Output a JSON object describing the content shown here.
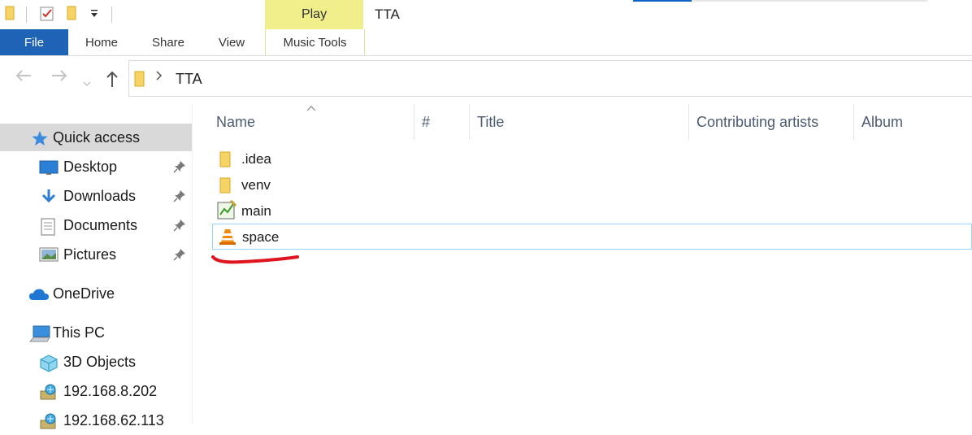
{
  "titlebar": {
    "window_title": "TTA",
    "contextual_group": "Play"
  },
  "ribbon": {
    "tabs": [
      {
        "label": "File"
      },
      {
        "label": "Home"
      },
      {
        "label": "Share"
      },
      {
        "label": "View"
      },
      {
        "label": "Music Tools"
      }
    ]
  },
  "address": {
    "path": "TTA"
  },
  "nav_pane": {
    "items": [
      {
        "label": "Quick access",
        "icon": "star-icon",
        "selected": true
      },
      {
        "label": "Desktop",
        "icon": "desktop-icon",
        "pinned": true
      },
      {
        "label": "Downloads",
        "icon": "download-arrow-icon",
        "pinned": true
      },
      {
        "label": "Documents",
        "icon": "document-icon",
        "pinned": true
      },
      {
        "label": "Pictures",
        "icon": "pictures-icon",
        "pinned": true
      },
      {
        "label": "OneDrive",
        "icon": "cloud-icon"
      },
      {
        "label": "This PC",
        "icon": "computer-icon"
      },
      {
        "label": "3D Objects",
        "icon": "cube-icon"
      },
      {
        "label": "192.168.8.202",
        "icon": "network-drive-icon"
      },
      {
        "label": "192.168.62.113",
        "icon": "network-drive-icon"
      }
    ]
  },
  "file_list": {
    "columns": [
      "Name",
      "#",
      "Title",
      "Contributing artists",
      "Album"
    ],
    "rows": [
      {
        "name": ".idea",
        "icon": "folder-icon"
      },
      {
        "name": "venv",
        "icon": "folder-icon"
      },
      {
        "name": "main",
        "icon": "python-file-icon"
      },
      {
        "name": "space",
        "icon": "vlc-cone-icon",
        "focused": true
      }
    ]
  },
  "colors": {
    "file_tab": "#1e63b5",
    "contextual_tab": "#f1ee8c",
    "selection": "#d9d9d9",
    "annotation": "#e0141e"
  }
}
